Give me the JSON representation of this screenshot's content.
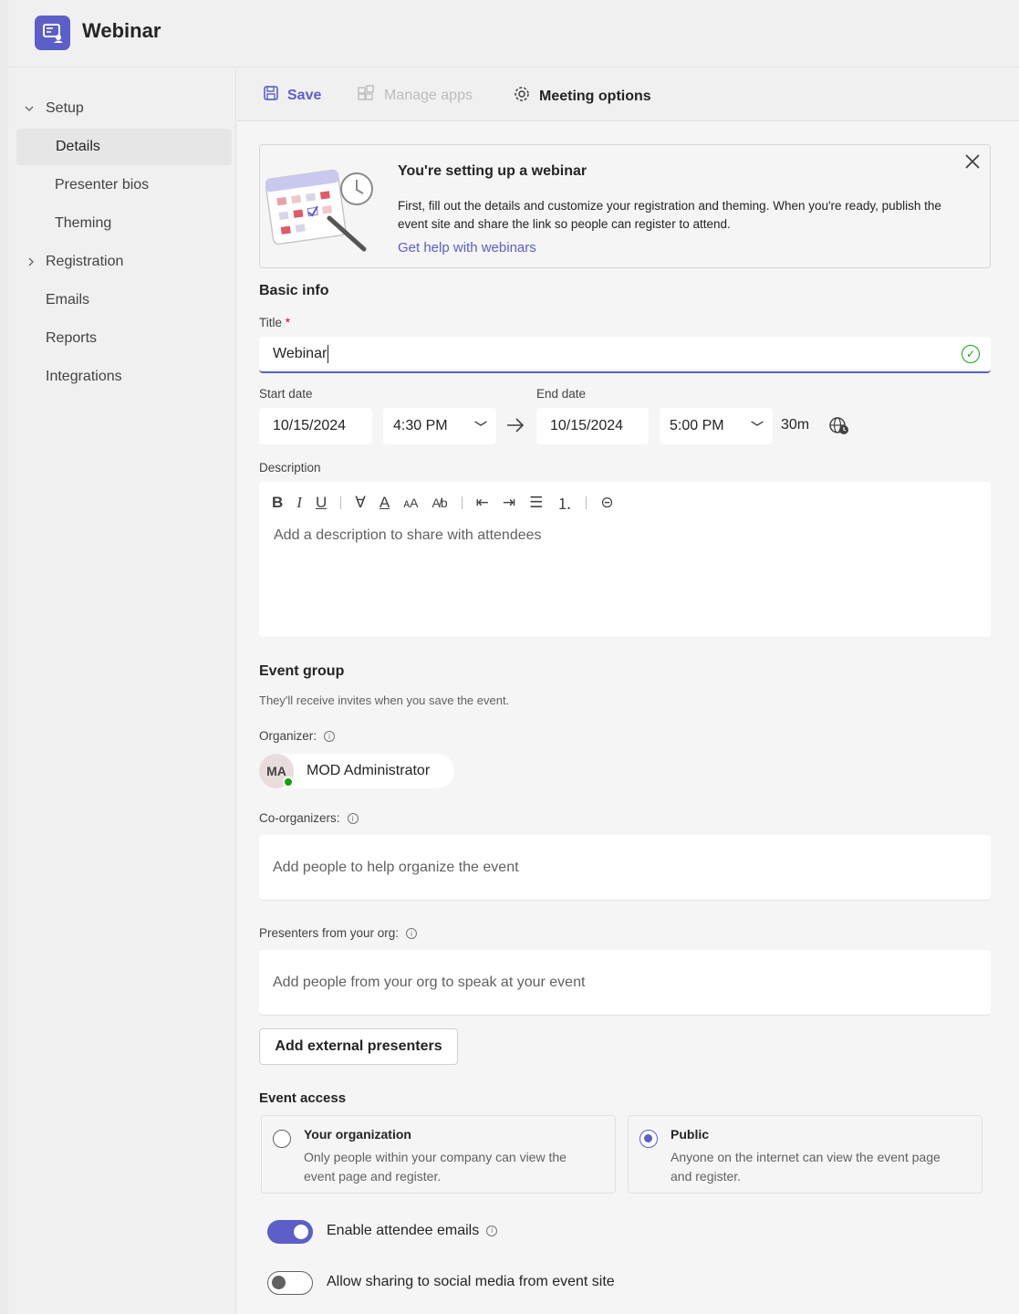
{
  "app": {
    "title": "Webinar"
  },
  "sidebar": {
    "items": [
      {
        "label": "Setup"
      },
      {
        "label": "Details"
      },
      {
        "label": "Presenter bios"
      },
      {
        "label": "Theming"
      },
      {
        "label": "Registration"
      },
      {
        "label": "Emails"
      },
      {
        "label": "Reports"
      },
      {
        "label": "Integrations"
      }
    ],
    "selected": "Details"
  },
  "toolbar": {
    "save_label": "Save",
    "manage_apps_label": "Manage apps",
    "meeting_options_label": "Meeting options"
  },
  "banner": {
    "title": "You're setting up a webinar",
    "body": "First, fill out the details and customize your registration and theming. When you're ready, publish the event site and share the link so people can register to attend.",
    "link": "Get help with webinars"
  },
  "basic_info": {
    "heading": "Basic info",
    "title_label": "Title",
    "required_marker": "*",
    "title_value": "Webinar",
    "start_date_label": "Start date",
    "start_date": "10/15/2024",
    "start_time": "4:30 PM",
    "end_date_label": "End date",
    "end_date": "10/15/2024",
    "end_time": "5:00 PM",
    "duration": "30m",
    "description_label": "Description",
    "description_placeholder": "Add a description to share with attendees"
  },
  "event_group": {
    "heading": "Event group",
    "subtext": "They'll receive invites when you save the event.",
    "organizer_label": "Organizer:",
    "organizer_initials": "MA",
    "organizer_name": "MOD Administrator",
    "coorganizers_label": "Co-organizers:",
    "coorganizers_placeholder": "Add people to help organize the event",
    "presenters_label": "Presenters from your org:",
    "presenters_placeholder": "Add people from your org to speak at your event",
    "add_external_label": "Add external presenters"
  },
  "event_access": {
    "heading": "Event access",
    "options": [
      {
        "title": "Your organization",
        "desc": "Only people within your company can view the event page and register.",
        "selected": false
      },
      {
        "title": "Public",
        "desc": "Anyone on the internet can view the event page and register.",
        "selected": true
      }
    ]
  },
  "toggles": [
    {
      "label": "Enable attendee emails",
      "on": true
    },
    {
      "label": "Allow sharing to social media from event site",
      "on": false
    }
  ],
  "colors": {
    "accent": "#5b5fc7",
    "success": "#13a10e",
    "required": "#c50f1f"
  }
}
